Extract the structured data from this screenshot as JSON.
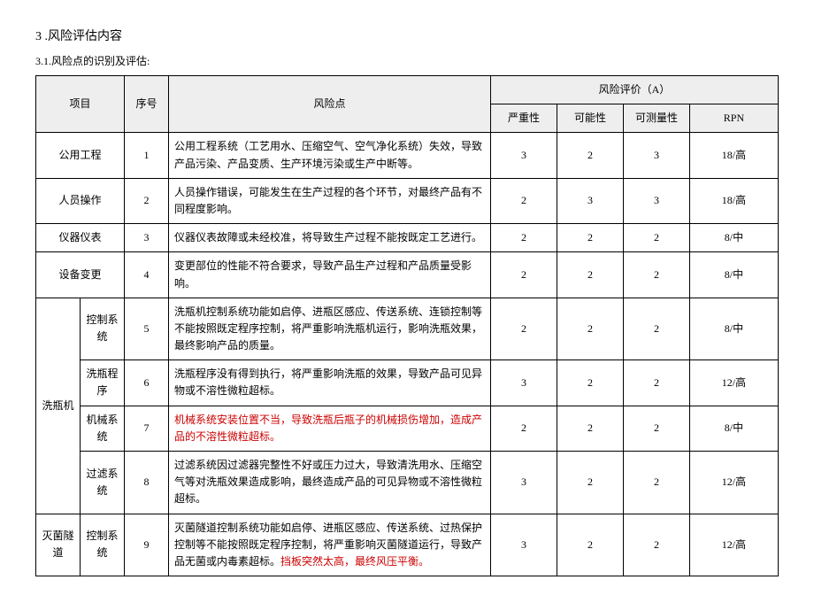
{
  "section": {
    "number": "3",
    "title": ".风险评估内容",
    "sub_number": "3.1.",
    "sub_title": "风险点的识别及评估:"
  },
  "header": {
    "project": "项目",
    "seq": "序号",
    "risk": "风险点",
    "eval": "风险评价（A）",
    "severity": "严重性",
    "probability": "可能性",
    "measurability": "可测量性",
    "rpn": "RPN"
  },
  "rows": [
    {
      "proj": "公用工程",
      "seq": "1",
      "desc": "公用工程系统（工艺用水、压缩空气、空气净化系统）失效，导致产品污染、产品变质、生产环境污染或生产中断等。",
      "sev": "3",
      "prob": "2",
      "meas": "3",
      "rpn": "18/高"
    },
    {
      "proj": "人员操作",
      "seq": "2",
      "desc": "人员操作错误，可能发生在生产过程的各个环节，对最终产品有不同程度影响。",
      "sev": "2",
      "prob": "3",
      "meas": "3",
      "rpn": "18/高"
    },
    {
      "proj": "仪器仪表",
      "seq": "3",
      "desc": "仪器仪表故障或未经校准，将导致生产过程不能按既定工艺进行。",
      "sev": "2",
      "prob": "2",
      "meas": "2",
      "rpn": "8/中"
    },
    {
      "proj": "设备变更",
      "seq": "4",
      "desc": "变更部位的性能不符合要求，导致产品生产过程和产品质量受影响。",
      "sev": "2",
      "prob": "2",
      "meas": "2",
      "rpn": "8/中"
    },
    {
      "proj_group": "洗瓶机",
      "sub": "控制系统",
      "seq": "5",
      "desc": "洗瓶机控制系统功能如启停、进瓶区感应、传送系统、连锁控制等不能按照既定程序控制，将严重影响洗瓶机运行，影响洗瓶效果，最终影响产品的质量。",
      "sev": "2",
      "prob": "2",
      "meas": "2",
      "rpn": "8/中"
    },
    {
      "sub": "洗瓶程序",
      "seq": "6",
      "desc": "洗瓶程序没有得到执行，将严重影响洗瓶的效果，导致产品可见异物或不溶性微粒超标。",
      "sev": "3",
      "prob": "2",
      "meas": "2",
      "rpn": "12/高"
    },
    {
      "sub": "机械系统",
      "seq": "7",
      "desc_red": "机械系统安装位置不当，导致洗瓶后瓶子的机械损伤增加，造成产品的不溶性微粒超标。",
      "sev": "2",
      "prob": "2",
      "meas": "2",
      "rpn": "8/中"
    },
    {
      "sub": "过滤系统",
      "seq": "8",
      "desc": "过滤系统因过滤器完整性不好或压力过大，导致清洗用水、压缩空气等对洗瓶效果造成影响，最终造成产品的可见异物或不溶性微粒超标。",
      "sev": "3",
      "prob": "2",
      "meas": "2",
      "rpn": "12/高"
    },
    {
      "proj_group": "灭菌隧道",
      "sub": "控制系统",
      "seq": "9",
      "desc_prefix": "灭菌隧道控制系统功能如启停、进瓶区感应、传送系统、过热保护控制等不能按照既定程序控制，将严重影响灭菌隧道运行，导致产品无菌或内毒素超标。",
      "desc_red": "挡板突然太高，最终风压平衡。",
      "sev": "3",
      "prob": "2",
      "meas": "2",
      "rpn": "12/高"
    }
  ]
}
